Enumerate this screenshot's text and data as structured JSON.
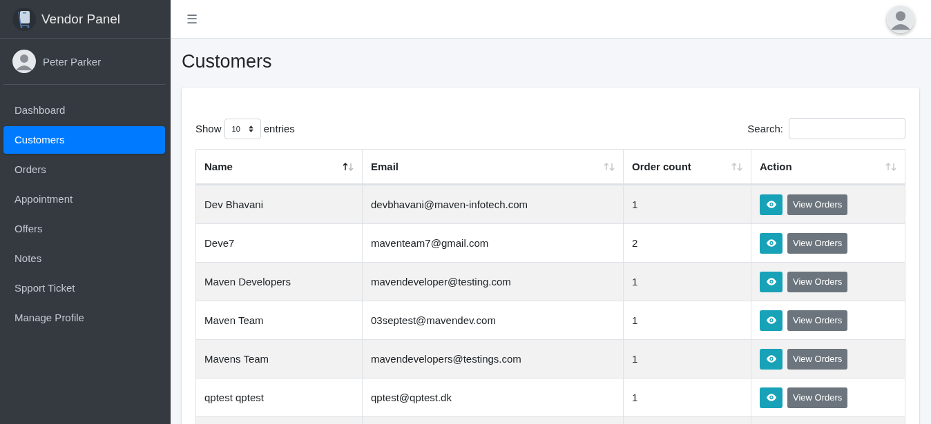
{
  "brand": {
    "title": "Vendor Panel"
  },
  "user": {
    "name": "Peter Parker"
  },
  "sidebar": {
    "items": [
      {
        "label": "Dashboard",
        "selected": false
      },
      {
        "label": "Customers",
        "selected": true
      },
      {
        "label": "Orders",
        "selected": false
      },
      {
        "label": "Appointment",
        "selected": false
      },
      {
        "label": "Offers",
        "selected": false
      },
      {
        "label": "Notes",
        "selected": false
      },
      {
        "label": "Spport Ticket",
        "selected": false
      },
      {
        "label": "Manage Profile",
        "selected": false
      }
    ]
  },
  "topbar": {
    "menu_icon": "☰"
  },
  "page": {
    "title": "Customers"
  },
  "table_controls": {
    "show_label": "Show",
    "page_size": "10",
    "entries_label": "entries",
    "search_label": "Search:"
  },
  "table": {
    "columns": [
      {
        "label": "Name",
        "sorted": true
      },
      {
        "label": "Email",
        "sorted": false
      },
      {
        "label": "Order count",
        "sorted": false
      },
      {
        "label": "Action",
        "sorted": false
      }
    ],
    "rows": [
      {
        "name": "Dev Bhavani",
        "email": "devbhavani@maven-infotech.com",
        "order_count": "1",
        "action": "View Orders"
      },
      {
        "name": "Deve7",
        "email": "maventeam7@gmail.com",
        "order_count": "2",
        "action": "View Orders"
      },
      {
        "name": "Maven Developers",
        "email": "mavendeveloper@testing.com",
        "order_count": "1",
        "action": "View Orders"
      },
      {
        "name": "Maven Team",
        "email": "03septest@mavendev.com",
        "order_count": "1",
        "action": "View Orders"
      },
      {
        "name": "Mavens Team",
        "email": "mavendevelopers@testings.com",
        "order_count": "1",
        "action": "View Orders"
      },
      {
        "name": "qptest qptest",
        "email": "qptest@qptest.dk",
        "order_count": "1",
        "action": "View Orders"
      }
    ]
  }
}
